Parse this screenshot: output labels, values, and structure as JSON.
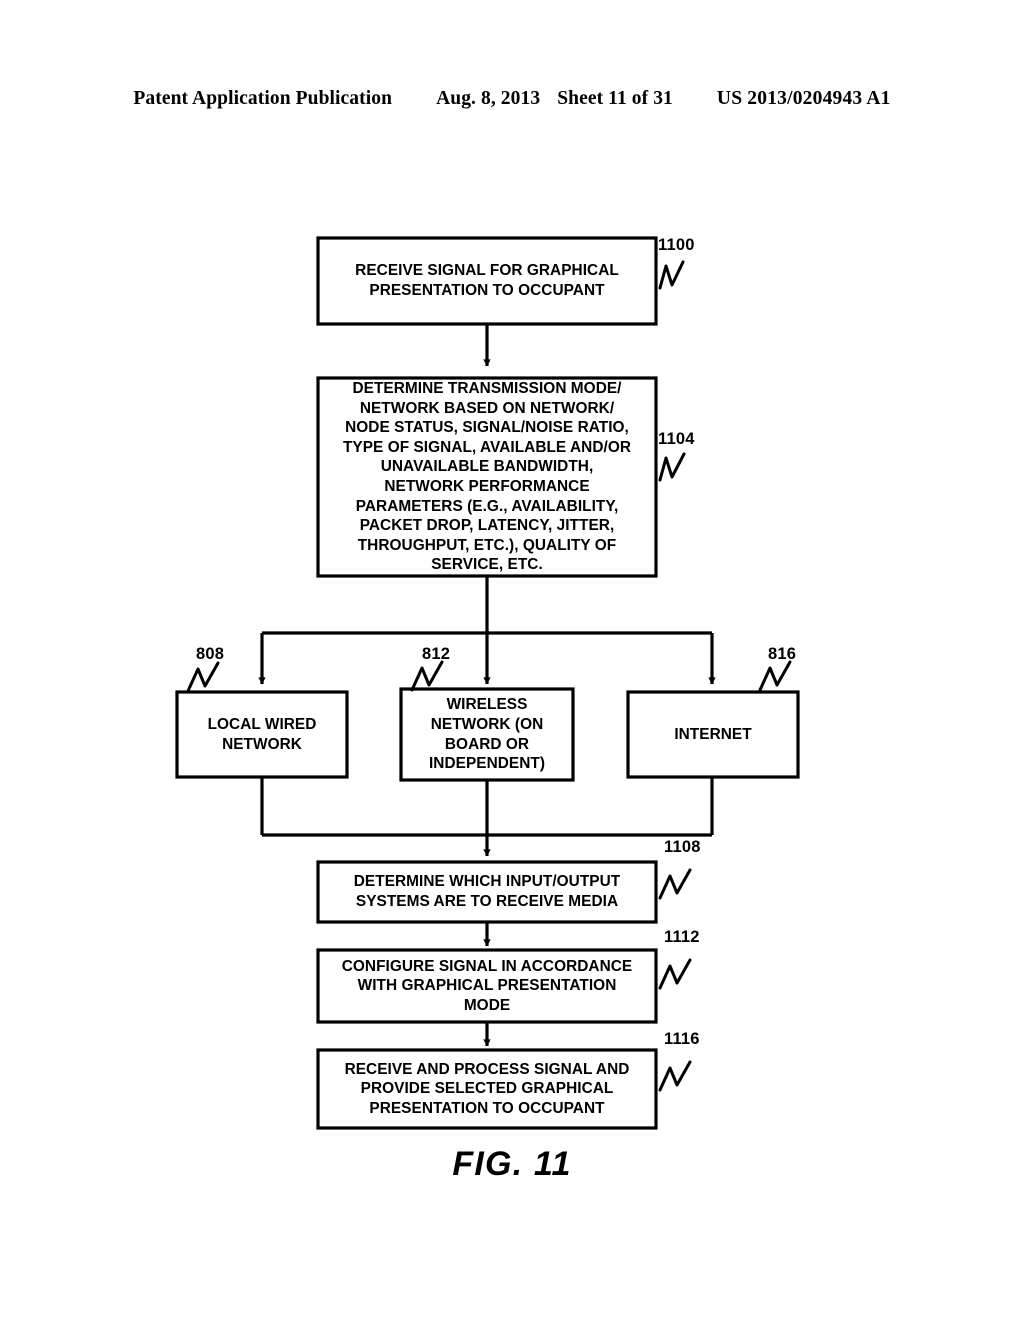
{
  "header": {
    "publication": "Patent Application Publication",
    "date": "Aug. 8, 2013",
    "sheet": "Sheet 11 of 31",
    "number": "US 2013/0204943 A1"
  },
  "figure": {
    "caption": "FIG. 11"
  },
  "boxes": {
    "receive_signal": {
      "ref": "1100",
      "lines": [
        "RECEIVE SIGNAL FOR GRAPHICAL",
        "PRESENTATION TO OCCUPANT"
      ]
    },
    "determine_transmission": {
      "ref": "1104",
      "lines": [
        "DETERMINE TRANSMISSION MODE/",
        "NETWORK BASED ON NETWORK/",
        "NODE STATUS, SIGNAL/NOISE RATIO,",
        "TYPE OF SIGNAL, AVAILABLE AND/OR",
        "UNAVAILABLE BANDWIDTH,",
        "NETWORK PERFORMANCE",
        "PARAMETERS (E.G., AVAILABILITY,",
        "PACKET DROP, LATENCY, JITTER,",
        "THROUGHPUT, ETC.), QUALITY OF",
        "SERVICE, ETC."
      ]
    },
    "local_wired_network": {
      "ref": "808",
      "lines": [
        "LOCAL WIRED",
        "NETWORK"
      ]
    },
    "wireless_network": {
      "ref": "812",
      "lines": [
        "WIRELESS",
        "NETWORK (ON",
        "BOARD OR",
        "INDEPENDENT)"
      ]
    },
    "internet": {
      "ref": "816",
      "lines": [
        "INTERNET"
      ]
    },
    "determine_io_systems": {
      "ref": "1108",
      "lines": [
        "DETERMINE WHICH INPUT/OUTPUT",
        "SYSTEMS ARE TO RECEIVE MEDIA"
      ]
    },
    "configure_signal": {
      "ref": "1112",
      "lines": [
        "CONFIGURE SIGNAL IN ACCORDANCE",
        "WITH GRAPHICAL PRESENTATION",
        "MODE"
      ]
    },
    "receive_and_process": {
      "ref": "1116",
      "lines": [
        "RECEIVE AND PROCESS SIGNAL AND",
        "PROVIDE SELECTED GRAPHICAL",
        "PRESENTATION TO OCCUPANT"
      ]
    }
  },
  "colors": {
    "ink": "#000000",
    "paper": "#ffffff"
  }
}
